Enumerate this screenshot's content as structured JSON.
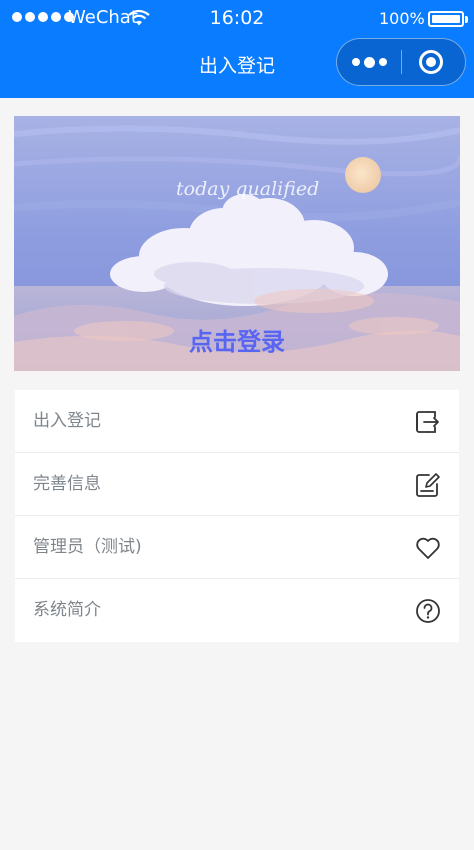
{
  "status_bar": {
    "carrier": "WeChat",
    "time": "16:02",
    "battery": "100%"
  },
  "nav": {
    "title": "出入登记"
  },
  "banner": {
    "caption": "today qualified",
    "login_label": "点击登录"
  },
  "menu": {
    "items": [
      {
        "label": "出入登记",
        "icon": "exit-icon"
      },
      {
        "label": "完善信息",
        "icon": "edit-icon"
      },
      {
        "label": "管理员（测试)",
        "icon": "heart-icon"
      },
      {
        "label": "系统简介",
        "icon": "help-icon"
      }
    ]
  },
  "colors": {
    "nav_bg": "#0a7cff",
    "page_bg": "#f5f5f5",
    "login_text": "#5865f2",
    "menu_label": "#7e868c"
  }
}
